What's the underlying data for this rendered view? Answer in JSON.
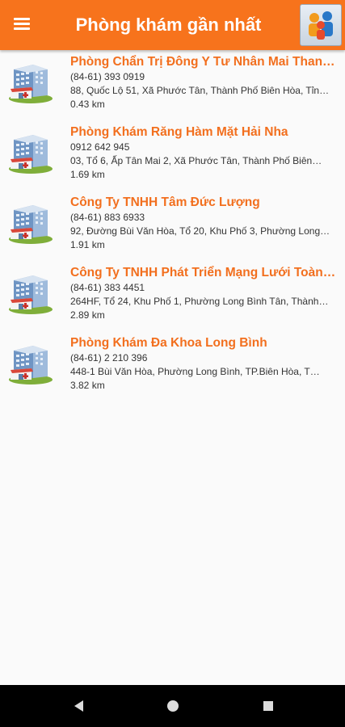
{
  "header": {
    "title": "Phòng khám gần nhất",
    "menu_icon": "hamburger-menu-icon",
    "logo_icon": "people-logo-icon"
  },
  "clinics": [
    {
      "name": "Phòng Chẩn Trị Đông Y Tư Nhân Mai Thanh…",
      "phone": "(84-61) 393 0919",
      "address": "88, Quốc Lộ 51, Xã Phước Tân, Thành Phố  Biên Hòa, Tỉn…",
      "distance": "0.43 km"
    },
    {
      "name": "Phòng Khám Răng Hàm Mặt Hải Nha",
      "phone": "0912 642 945",
      "address": "03, Tổ 6, Ấp Tân Mai 2, Xã Phước Tân, Thành Phố  Biên…",
      "distance": "1.69 km"
    },
    {
      "name": "Công Ty TNHH Tâm Đức Lượng",
      "phone": "(84-61) 883 6933",
      "address": "92, Đường Bùi Văn Hòa, Tổ 20, Khu Phố 3, Phường Long…",
      "distance": "1.91 km"
    },
    {
      "name": "Công Ty TNHH Phát Triển Mạng Lưới Toàn C…",
      "phone": "(84-61) 383 4451",
      "address": "264HF, Tổ 24, Khu Phố 1, Phường Long Bình Tân, Thành…",
      "distance": "2.89 km"
    },
    {
      "name": "Phòng Khám Đa Khoa Long Bình",
      "phone": "(84-61) 2 210 396",
      "address": "448-1   Bùi Văn Hòa,  Phường Long Bình, TP.Biên Hòa, T…",
      "distance": "3.82 km"
    }
  ],
  "navbar": {
    "back_icon": "back-triangle-icon",
    "home_icon": "home-circle-icon",
    "recents_icon": "recents-square-icon"
  },
  "colors": {
    "accent": "#f7731c",
    "name_text": "#f26f1e",
    "navbar": "#000000"
  }
}
